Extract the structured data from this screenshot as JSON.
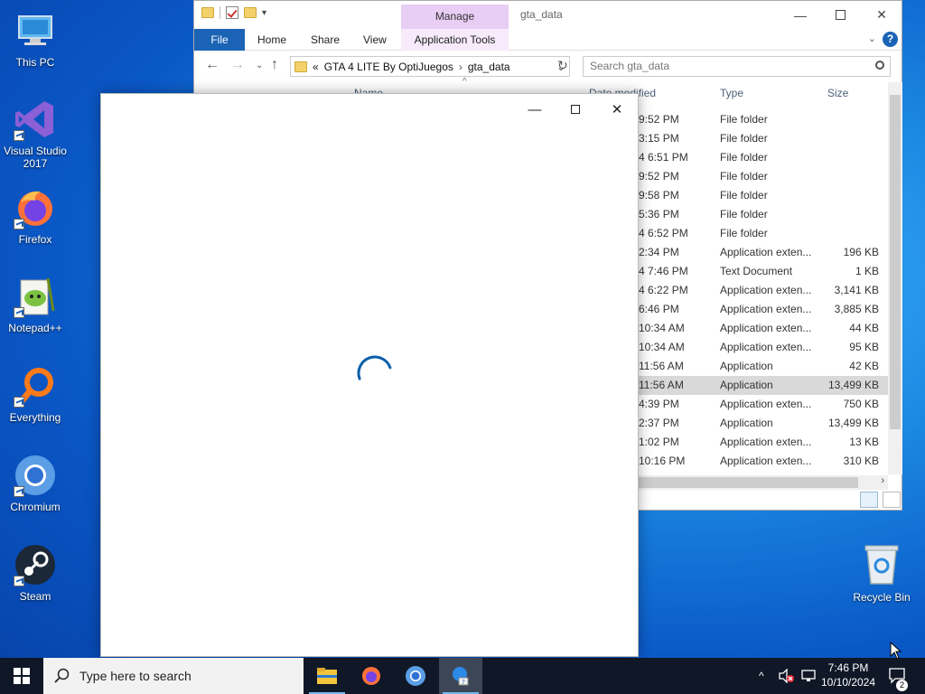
{
  "desktop": {
    "icons": [
      {
        "label": "This PC",
        "icon": "this-pc-icon"
      },
      {
        "label": "Visual Studio 2017",
        "icon": "visual-studio-icon"
      },
      {
        "label": "Firefox",
        "icon": "firefox-icon"
      },
      {
        "label": "Notepad++",
        "icon": "notepad-plus-plus-icon"
      },
      {
        "label": "Everything",
        "icon": "everything-icon"
      },
      {
        "label": "Chromium",
        "icon": "chromium-icon"
      },
      {
        "label": "Steam",
        "icon": "steam-icon"
      }
    ],
    "recycle_bin": {
      "label": "Recycle Bin"
    }
  },
  "explorer": {
    "title": "gta_data",
    "context_tab": "Manage",
    "ribbon_tabs": [
      "File",
      "Home",
      "Share",
      "View",
      "Application Tools"
    ],
    "address": {
      "prefix": "«",
      "segments": [
        "GTA 4 LITE By OptiJuegos",
        "gta_data"
      ]
    },
    "search_placeholder": "Search gta_data",
    "columns": {
      "name": "Name",
      "date": "Date modified",
      "type": "Type",
      "size": "Size"
    },
    "rows": [
      {
        "date": "9:52 PM",
        "type": "File folder",
        "size": ""
      },
      {
        "date": "3:15 PM",
        "type": "File folder",
        "size": ""
      },
      {
        "date": "4 6:51 PM",
        "type": "File folder",
        "size": ""
      },
      {
        "date": "9:52 PM",
        "type": "File folder",
        "size": ""
      },
      {
        "date": "9:58 PM",
        "type": "File folder",
        "size": ""
      },
      {
        "date": "5:36 PM",
        "type": "File folder",
        "size": ""
      },
      {
        "date": "4 6:52 PM",
        "type": "File folder",
        "size": ""
      },
      {
        "date": "2:34 PM",
        "type": "Application exten...",
        "size": "196 KB"
      },
      {
        "date": "4 7:46 PM",
        "type": "Text Document",
        "size": "1 KB"
      },
      {
        "date": "4 6:22 PM",
        "type": "Application exten...",
        "size": "3,141 KB"
      },
      {
        "date": "6:46 PM",
        "type": "Application exten...",
        "size": "3,885 KB"
      },
      {
        "date": "10:34 AM",
        "type": "Application exten...",
        "size": "44 KB"
      },
      {
        "date": "10:34 AM",
        "type": "Application exten...",
        "size": "95 KB"
      },
      {
        "date": "11:56 AM",
        "type": "Application",
        "size": "42 KB"
      },
      {
        "date": "11:56 AM",
        "type": "Application",
        "size": "13,499 KB",
        "selected": true
      },
      {
        "date": "4:39 PM",
        "type": "Application exten...",
        "size": "750 KB"
      },
      {
        "date": "2:37 PM",
        "type": "Application",
        "size": "13,499 KB"
      },
      {
        "date": "1:02 PM",
        "type": "Application exten...",
        "size": "13 KB"
      },
      {
        "date": "10:16 PM",
        "type": "Application exten...",
        "size": "310 KB"
      }
    ]
  },
  "taskbar": {
    "search_placeholder": "Type here to search",
    "apps": [
      "file-explorer-icon",
      "firefox-icon",
      "chromium-icon",
      "setup-app-icon"
    ],
    "time": "7:46 PM",
    "date": "10/10/2024",
    "notification_count": "2"
  }
}
